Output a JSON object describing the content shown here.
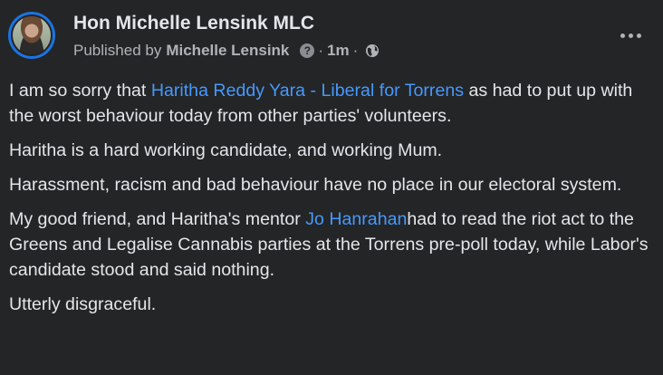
{
  "post": {
    "author": "Hon Michelle Lensink MLC",
    "published_prefix": "Published by",
    "published_by": "Michelle Lensink",
    "help_glyph": "?",
    "separator": "·",
    "time": "1m",
    "audience_icon": "globe-icon",
    "more_icon": "more-options-icon",
    "paragraphs": {
      "p1_before": "I am so sorry that ",
      "p1_link": "Haritha Reddy Yara - Liberal for Torrens",
      "p1_after": " as had to put up with the worst behaviour today from other parties' volunteers.",
      "p2": "Haritha is a hard working candidate, and working Mum.",
      "p3": "Harassment, racism and bad behaviour have no place in our electoral system.",
      "p4_before": "My good friend, and Haritha's mentor ",
      "p4_link": "Jo Hanrahan",
      "p4_after": "had to read the riot act to the Greens and Legalise Cannabis parties at the Torrens pre-poll today, while Labor's candidate stood and said nothing.",
      "p5": "Utterly disgraceful."
    }
  },
  "colors": {
    "background": "#242526",
    "text": "#e4e6eb",
    "secondary_text": "#b0b3b8",
    "link": "#4599ff",
    "avatar_ring": "#1b74e4"
  }
}
